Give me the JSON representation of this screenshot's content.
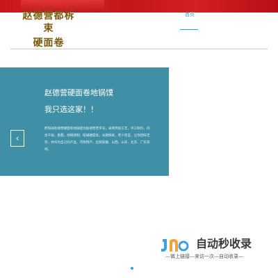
{
  "logo": {
    "line1": "赵德营都柝束",
    "line2": "硬面卷"
  },
  "nav": {
    "home_label": "首页"
  },
  "banner": {
    "title": "赵德营硬面卷地锅馍",
    "subtitle": "我只选这家！！",
    "description": "原阳县赵德营硬面卷地锅馍为赵德营老字号，采用传统工艺，手工制作，内含千层，香甜，地锅烧制，取碱硬度高，长期保鲜，老少皆宜，让你回味无穷，并作为自己的产品，河南特产，远销安徽、山西、山东、北京、广东等地。",
    "prev_icon": "chevron-left-icon"
  },
  "watermark": {
    "title": "自动秒收录",
    "slogan": "—做上链接—来访一次—自动收录—"
  },
  "colors": {
    "top_bar": "#c8141a",
    "banner": "#3f8fa7",
    "accent": "#2aa8c8"
  }
}
